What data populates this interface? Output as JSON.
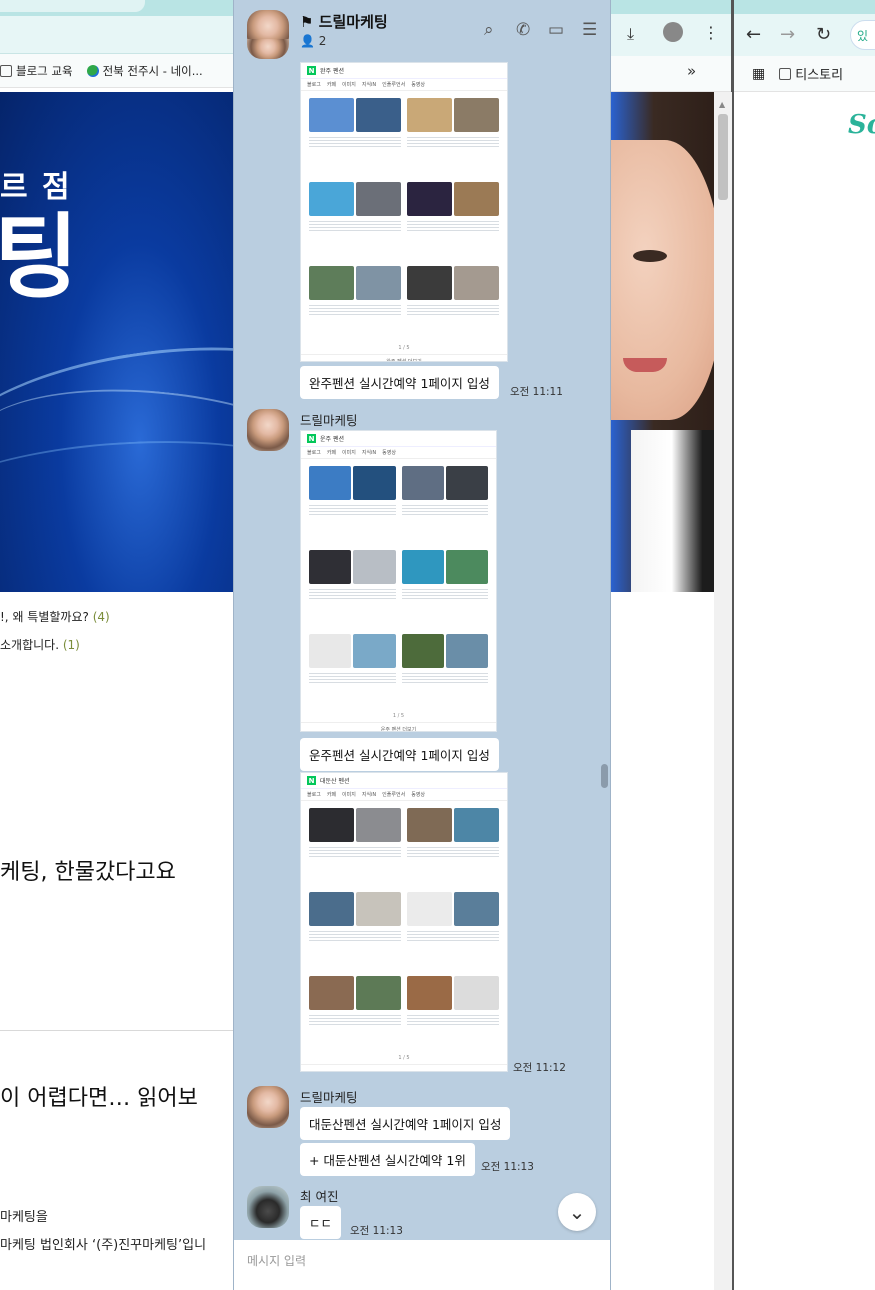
{
  "left_browser": {
    "bookmarks": [
      "블로그 교육",
      "전북 전주시 - 네이..."
    ],
    "hero_sub": "르 점",
    "hero_big": "팅",
    "posts": [
      {
        "text": "!, 왜 특별할까요?",
        "count": "(4)"
      },
      {
        "text": "소개합니다.",
        "count": "(1)"
      }
    ],
    "heading1": "케팅, 한물갔다고요",
    "heading2": "이 어렵다면… 읽어보",
    "body1": "마케팅을",
    "body2": "마케팅 법인회사 ‘(주)진꾸마케팅’입니"
  },
  "right_browser": {
    "bookmark_folder": "티스토리",
    "logo": "So",
    "addr_text": "있"
  },
  "chat": {
    "title": "드릴마케팅",
    "member_count": "2",
    "input_placeholder": "메시지 입력",
    "colors": {
      "background": "#bacee0",
      "bubble": "#ffffff",
      "naver_green": "#03c75a"
    },
    "shots": [
      {
        "query": "완주 펜션",
        "more": "완주 펜션 더보기"
      },
      {
        "query": "운주 펜션",
        "more": "운주 펜션 더보기"
      },
      {
        "query": "대둔산 펜션",
        "more": ""
      }
    ],
    "messages": [
      {
        "text": "완주펜션 실시간예약 1페이지 입성",
        "time": "오전 11:11"
      },
      {
        "sender": "드릴마케팅",
        "text": "운주펜션 실시간예약 1페이지 입성"
      },
      {
        "time": "오전 11:12"
      },
      {
        "sender": "드릴마케팅",
        "text": "대둔산펜션 실시간예약 1페이지 입성"
      },
      {
        "text": "+ 대둔산펜션 실시간예약 1위",
        "time": "오전 11:13"
      },
      {
        "sender": "최 여진",
        "text": "ㄷㄷ",
        "time": "오전 11:13"
      }
    ]
  }
}
